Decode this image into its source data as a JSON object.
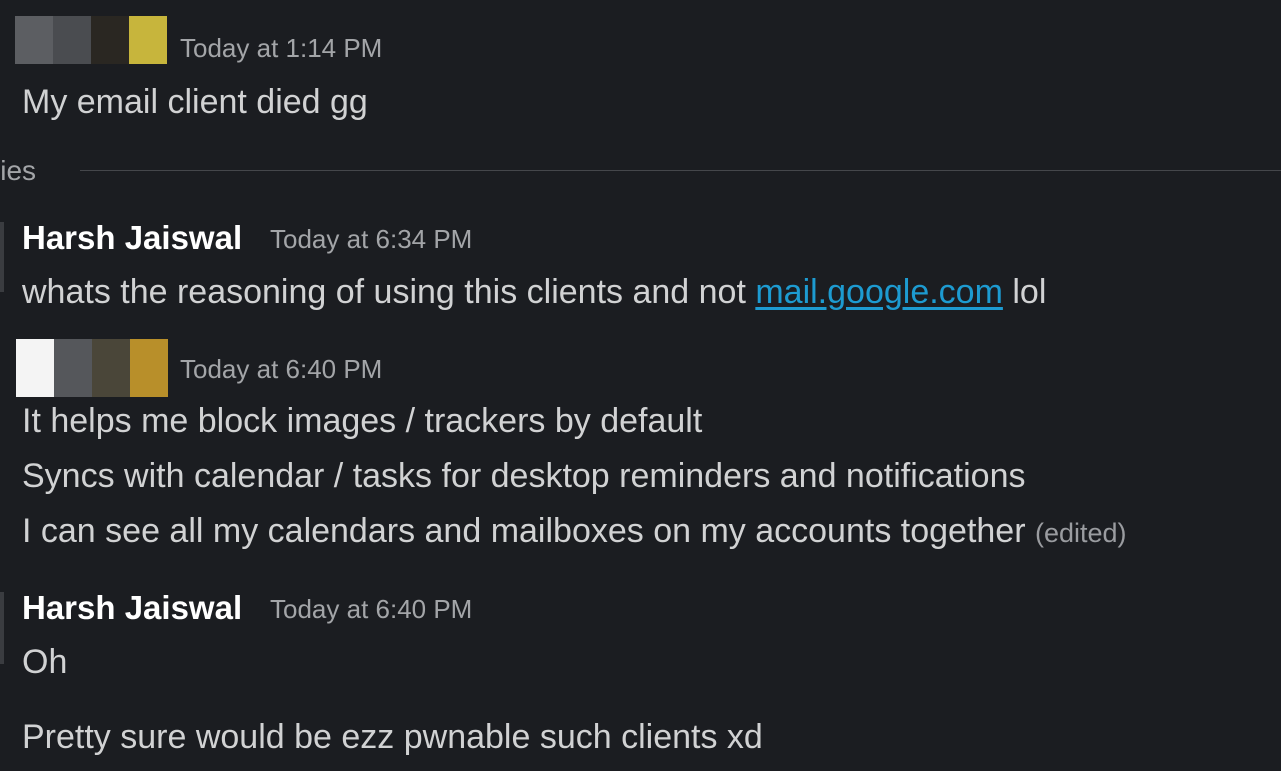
{
  "messages": [
    {
      "timestamp": "Today at 1:14 PM",
      "lines": [
        "My email client died gg"
      ]
    }
  ],
  "replies": {
    "label": "lies"
  },
  "reply_messages": [
    {
      "author": "Harsh Jaiswal",
      "timestamp": "Today at 6:34 PM",
      "text_before_link": "whats the reasoning of using this clients and not ",
      "link_text": "mail.google.com",
      "text_after_link": " lol"
    },
    {
      "timestamp": "Today at 6:40 PM",
      "lines": [
        "It helps me block images / trackers by default",
        "Syncs with calendar / tasks for desktop reminders and notifications",
        "I can see all my calendars and mailboxes on my accounts together"
      ],
      "edited_label": "(edited)"
    },
    {
      "author": "Harsh Jaiswal",
      "timestamp": "Today at 6:40 PM",
      "lines": [
        "Oh",
        "Pretty sure would be ezz pwnable such clients xd"
      ]
    }
  ],
  "colors": {
    "background": "#1b1d21",
    "text": "#d1d2d3",
    "link": "#1d9bd1",
    "muted": "#a3a5a8",
    "redaction_1": [
      "#5c5e62",
      "#4a4c50",
      "#2a2722",
      "#c7b53c"
    ],
    "redaction_2": [
      "#f4f4f4",
      "#55575b",
      "#4a4639",
      "#b88f2a"
    ]
  }
}
